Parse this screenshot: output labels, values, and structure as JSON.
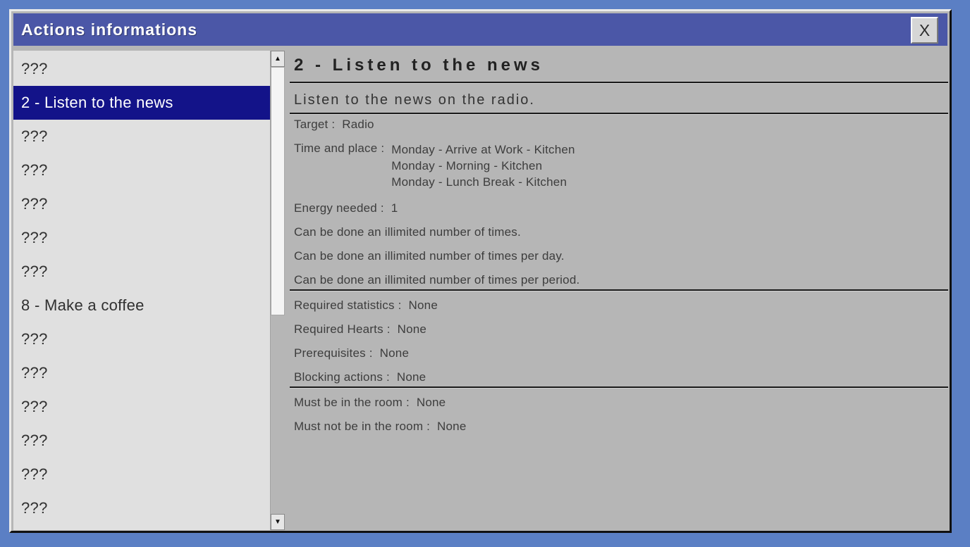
{
  "colors": {
    "desktop": "#5b7fc4",
    "titlebar": "#4b57a7",
    "window_bg": "#b6b6b6",
    "list_bg": "#e0e0e0",
    "selected_bg": "#131389",
    "selected_text": "#ffffff",
    "text": "#303030",
    "rule": "#1a1a1a"
  },
  "window": {
    "title": "Actions informations",
    "close_label": "X"
  },
  "scrollbar": {
    "up_glyph": "▲",
    "down_glyph": "▼"
  },
  "action_list": {
    "items": [
      {
        "label": "???",
        "selected": false
      },
      {
        "label": "2 - Listen to the news",
        "selected": true
      },
      {
        "label": "???",
        "selected": false
      },
      {
        "label": "???",
        "selected": false
      },
      {
        "label": "???",
        "selected": false
      },
      {
        "label": "???",
        "selected": false
      },
      {
        "label": "???",
        "selected": false
      },
      {
        "label": "8 - Make a coffee",
        "selected": false
      },
      {
        "label": "???",
        "selected": false
      },
      {
        "label": "???",
        "selected": false
      },
      {
        "label": "???",
        "selected": false
      },
      {
        "label": "???",
        "selected": false
      },
      {
        "label": "???",
        "selected": false
      },
      {
        "label": "???",
        "selected": false
      }
    ]
  },
  "detail": {
    "title": "2 - Listen to the news",
    "description": "Listen to the news on the radio.",
    "rows": [
      {
        "type": "labelvalue",
        "label": "Target :",
        "value": "Radio"
      },
      {
        "type": "labelmultivalue",
        "label": "Time and place :",
        "values": [
          "Monday - Arrive at Work - Kitchen",
          "Monday - Morning - Kitchen",
          "Monday - Lunch Break - Kitchen"
        ]
      },
      {
        "type": "labelvalue",
        "label": "Energy needed :",
        "value": "1"
      },
      {
        "type": "text",
        "text": "Can be done an illimited number of times."
      },
      {
        "type": "text",
        "text": "Can be done an illimited number of times per day."
      },
      {
        "type": "text",
        "text": "Can be done an illimited number of times per period."
      },
      {
        "type": "rule"
      },
      {
        "type": "labelvalue",
        "label": "Required statistics :",
        "value": "None"
      },
      {
        "type": "labelvalue",
        "label": "Required Hearts :",
        "value": "None"
      },
      {
        "type": "labelvalue",
        "label": "Prerequisites :",
        "value": "None"
      },
      {
        "type": "labelvalue",
        "label": "Blocking actions :",
        "value": "None"
      },
      {
        "type": "rule"
      },
      {
        "type": "labelvalue",
        "label": "Must be in the room :",
        "value": "None"
      },
      {
        "type": "labelvalue",
        "label": "Must not be in the room :",
        "value": "None"
      }
    ]
  }
}
